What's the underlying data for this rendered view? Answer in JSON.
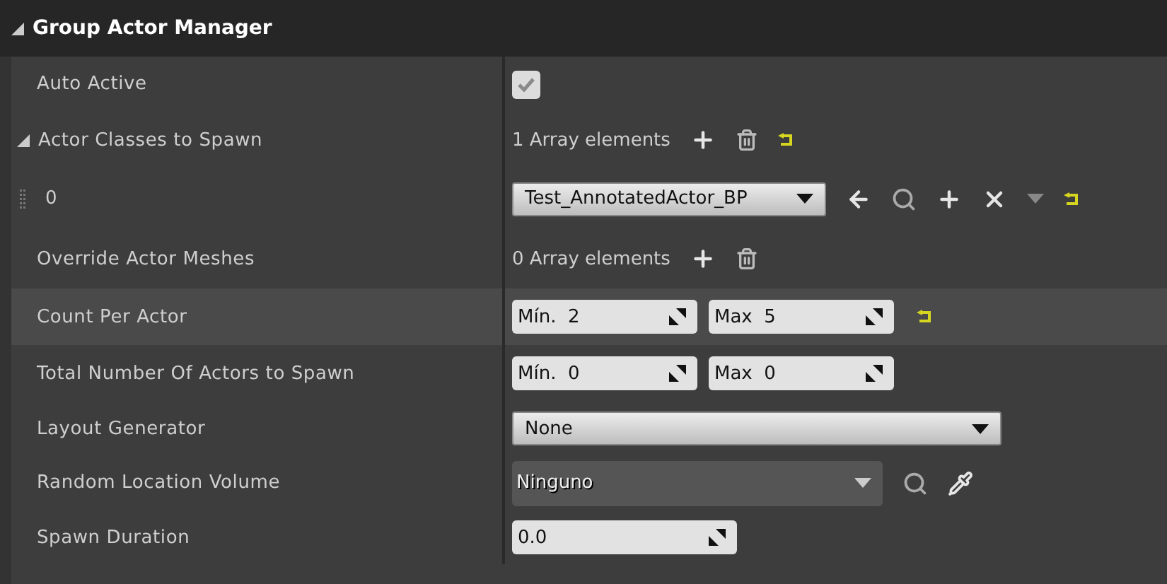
{
  "header": {
    "title": "Group Actor Manager",
    "expanded": true
  },
  "rows": [
    {
      "kind": "checkbox",
      "label": "Auto Active",
      "checked": true,
      "selected": false
    },
    {
      "kind": "array",
      "label": "Actor Classes to Spawn",
      "expanded": true,
      "count": "1 Array elements",
      "reset": true,
      "selected": false
    },
    {
      "kind": "class_picker",
      "label": "0",
      "value": "Test_AnnotatedActor_BP",
      "reset": true,
      "selected": false
    },
    {
      "kind": "array",
      "label": "Override Actor Meshes",
      "count": "0 Array elements",
      "reset": false,
      "selected": false
    },
    {
      "kind": "range",
      "label": "Count Per Actor",
      "min_label": "Mín.",
      "min": "2",
      "max_label": "Max",
      "max": "5",
      "reset": true,
      "selected": true
    },
    {
      "kind": "range",
      "label": "Total Number Of Actors to Spawn",
      "min_label": "Mín.",
      "min": "0",
      "max_label": "Max",
      "max": "0",
      "reset": false,
      "selected": false
    },
    {
      "kind": "combo",
      "label": "Layout Generator",
      "value": "None",
      "selected": false
    },
    {
      "kind": "asset",
      "label": "Random Location Volume",
      "value": "Ninguno",
      "selected": false
    },
    {
      "kind": "number",
      "label": "Spawn Duration",
      "value": "0.0",
      "selected": false
    }
  ]
}
